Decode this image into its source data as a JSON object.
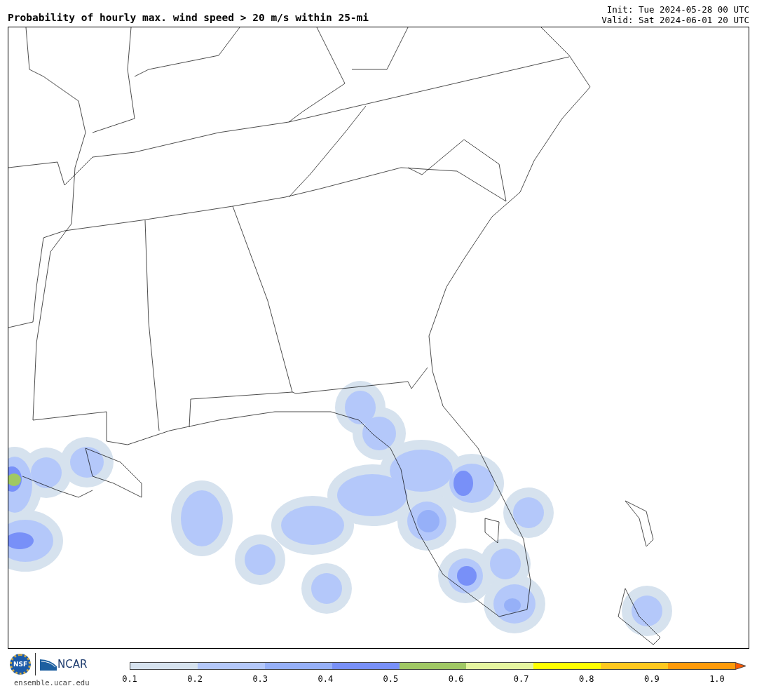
{
  "title": "Probability of hourly max. wind speed > 20 m/s within 25-mi",
  "init": "Init: Tue 2024-05-28 00 UTC",
  "valid": "Valid: Sat 2024-06-01 20 UTC",
  "logos": {
    "nsf_text": "NSF",
    "ncar_text": "NCAR",
    "url": "ensemble.ucar.edu"
  },
  "colorbar": {
    "bins": [
      {
        "color": "#d6e2ee"
      },
      {
        "color": "#b4c8fa"
      },
      {
        "color": "#96b0f8"
      },
      {
        "color": "#7890f8"
      },
      {
        "color": "#a0c864"
      },
      {
        "color": "#e6f5a0"
      },
      {
        "color": "#ffff00"
      },
      {
        "color": "#ffc81e"
      },
      {
        "color": "#ff9b0a"
      },
      {
        "kind": "arrow",
        "color": "#ff5a00"
      }
    ],
    "ticks": [
      "0.1",
      "0.2",
      "0.3",
      "0.4",
      "0.5",
      "0.6",
      "0.7",
      "0.8",
      "0.9",
      "1.0"
    ]
  }
}
